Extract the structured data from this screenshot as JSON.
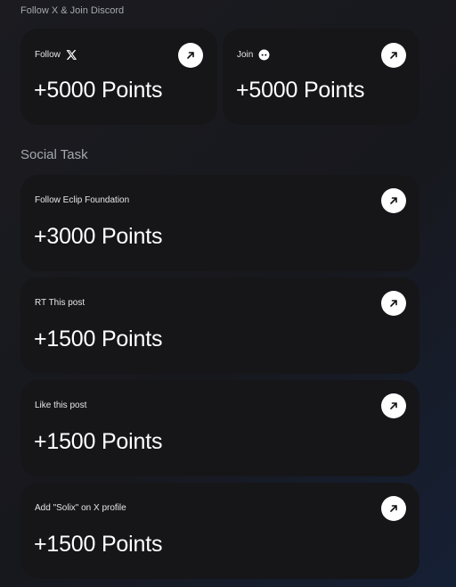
{
  "sections": {
    "top_title": "Follow X & Join Discord",
    "social_title": "Social Task"
  },
  "top_cards": [
    {
      "label": "Follow",
      "icon": "x-logo-icon",
      "points": "+5000 Points"
    },
    {
      "label": "Join",
      "icon": "discord-icon",
      "points": "+5000 Points"
    }
  ],
  "social_tasks": [
    {
      "label": "Follow Eclip Foundation",
      "points": "+3000 Points"
    },
    {
      "label": "RT This post",
      "points": "+1500 Points"
    },
    {
      "label": "Like this post",
      "points": "+1500 Points"
    },
    {
      "label": "Add \"Solix\" on X profile",
      "points": "+1500 Points"
    }
  ],
  "icons": {
    "action": "arrow-up-right-icon"
  },
  "colors": {
    "card_bg": "#161619",
    "page_bg": "#1b1b20",
    "muted_text": "#a6a8b0"
  }
}
